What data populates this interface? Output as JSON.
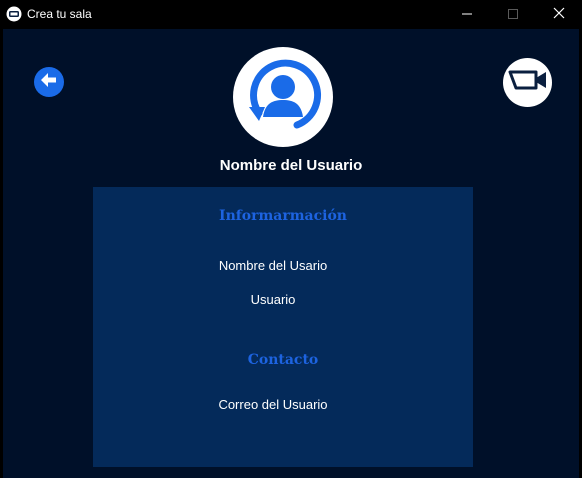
{
  "window": {
    "title": "Crea tu sala",
    "controls": {
      "minimize_icon": "minimize-icon",
      "maximize_icon": "maximize-icon",
      "close_icon": "close-icon"
    }
  },
  "header": {
    "back_icon": "arrow-left-icon",
    "camera_icon": "video-camera-icon",
    "avatar_icon": "user-refresh-icon",
    "user_name": "Nombre del Usuario"
  },
  "card": {
    "info_title": "Informarmación",
    "full_name": "Nombre del Usario",
    "username": "Usuario",
    "contact_title": "Contacto",
    "email": "Correo del Usuario"
  },
  "colors": {
    "background": "#001029",
    "card": "#042a5a",
    "accent": "#1d63e0",
    "text": "#ffffff"
  }
}
